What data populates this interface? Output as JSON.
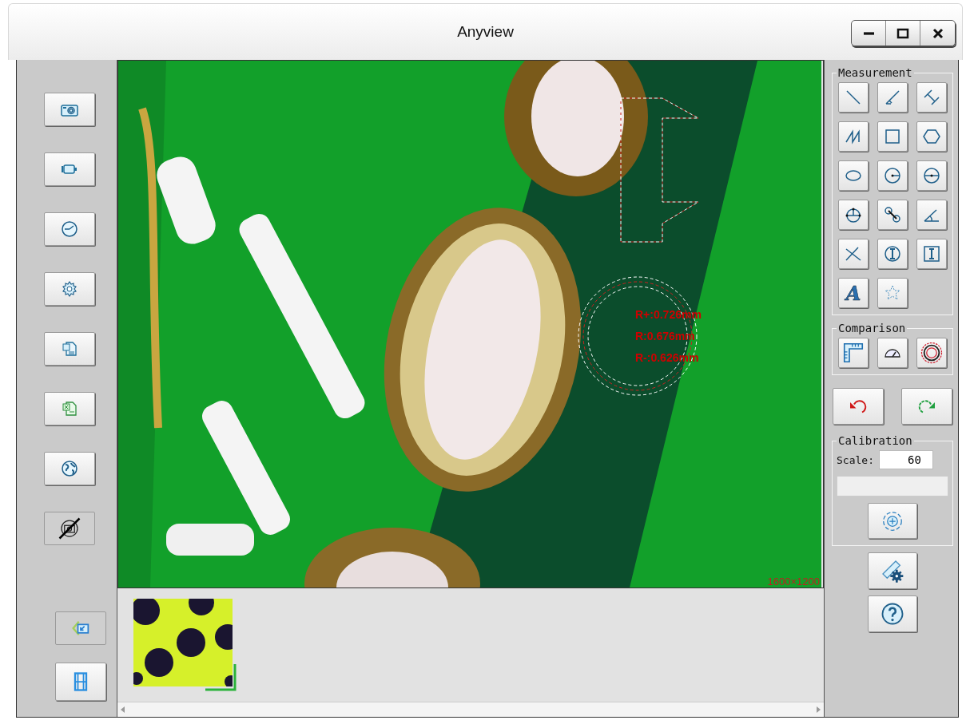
{
  "window": {
    "title": "Anyview"
  },
  "viewer": {
    "measurements": [
      "R+:0.726mm",
      "R:0.676mm",
      "R-:0.626mm"
    ],
    "resolution": "1600×1200"
  },
  "thumbnails": [
    {
      "kind": "picture",
      "selected": true
    }
  ],
  "measurement_panel": {
    "title": "Measurement",
    "text_tool": "A"
  },
  "comparison_panel": {
    "title": "Comparison"
  },
  "calibration": {
    "title": "Calibration",
    "scale_label": "Scale:",
    "scale_value": "60"
  }
}
